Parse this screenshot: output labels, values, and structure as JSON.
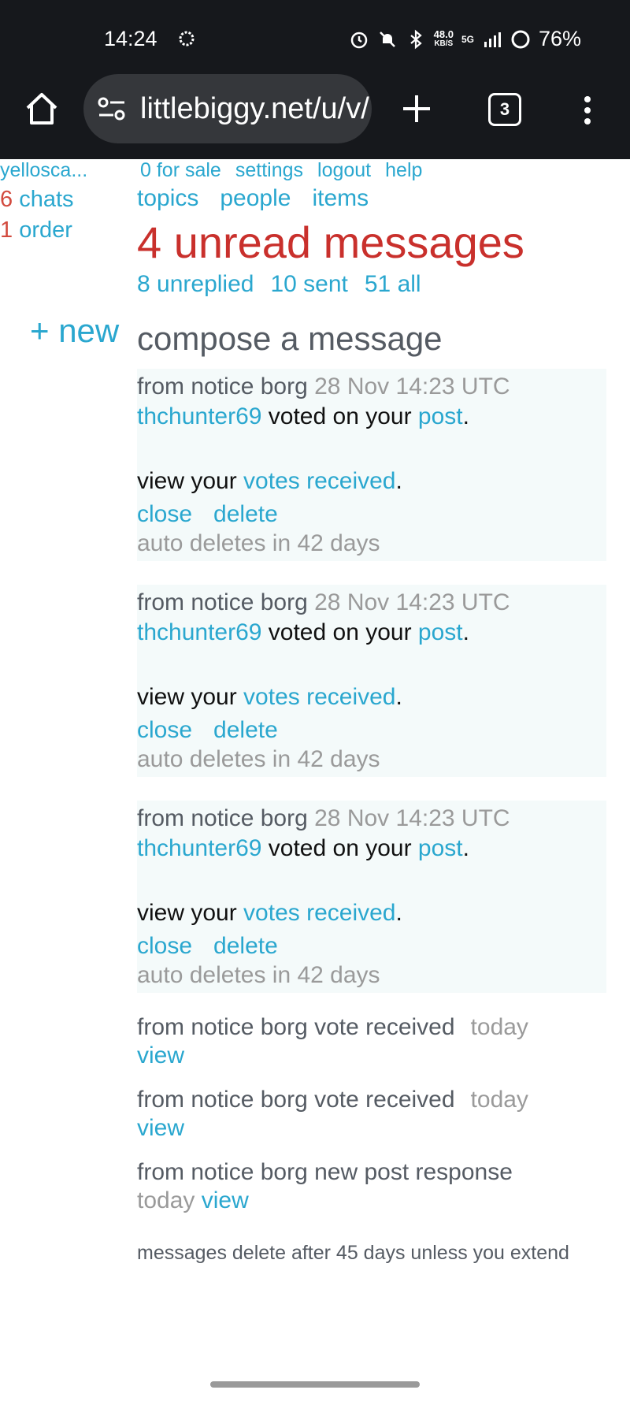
{
  "status_bar": {
    "time": "14:24",
    "speed_value": "48.0",
    "speed_unit": "KB/S",
    "network": "5G",
    "battery": "76%"
  },
  "browser": {
    "url": "littlebiggy.net/u/v/",
    "tab_count": "3"
  },
  "sidebar": {
    "username": "yellosca...",
    "chats_count": "6",
    "chats_label": "chats",
    "orders_count": "1",
    "orders_label": "order",
    "new_label": "+ new"
  },
  "top_nav": [
    "0 for sale",
    "settings",
    "logout",
    "help"
  ],
  "section_nav": [
    "topics",
    "people",
    "items"
  ],
  "headline": "4 unread messages",
  "sub_nav": [
    "8 unreplied",
    "10 sent",
    "51 all"
  ],
  "compose_label": "compose a message",
  "messages": [
    {
      "from": "from notice borg",
      "timestamp": "28 Nov 14:23 UTC",
      "user": "thchunter69",
      "voted_text": " voted on your ",
      "post_link": "post",
      "view_text": "view your ",
      "votes_link": "votes received",
      "close_label": "close",
      "delete_label": "delete",
      "auto_delete": "auto deletes in 42 days"
    },
    {
      "from": "from notice borg",
      "timestamp": "28 Nov 14:23 UTC",
      "user": "thchunter69",
      "voted_text": " voted on your ",
      "post_link": "post",
      "view_text": "view your ",
      "votes_link": "votes received",
      "close_label": "close",
      "delete_label": "delete",
      "auto_delete": "auto deletes in 42 days"
    },
    {
      "from": "from notice borg",
      "timestamp": "28 Nov 14:23 UTC",
      "user": "thchunter69",
      "voted_text": " voted on your ",
      "post_link": "post",
      "view_text": "view your ",
      "votes_link": "votes received",
      "close_label": "close",
      "delete_label": "delete",
      "auto_delete": "auto deletes in 42 days"
    }
  ],
  "notices": [
    {
      "text": "from notice borg vote received",
      "time": "today",
      "view": "view"
    },
    {
      "text": "from notice borg vote received",
      "time": "today",
      "view": "view"
    },
    {
      "text": "from notice borg new post response",
      "time": "today",
      "view": "view"
    }
  ],
  "footnote": "messages delete after 45 days unless you extend"
}
